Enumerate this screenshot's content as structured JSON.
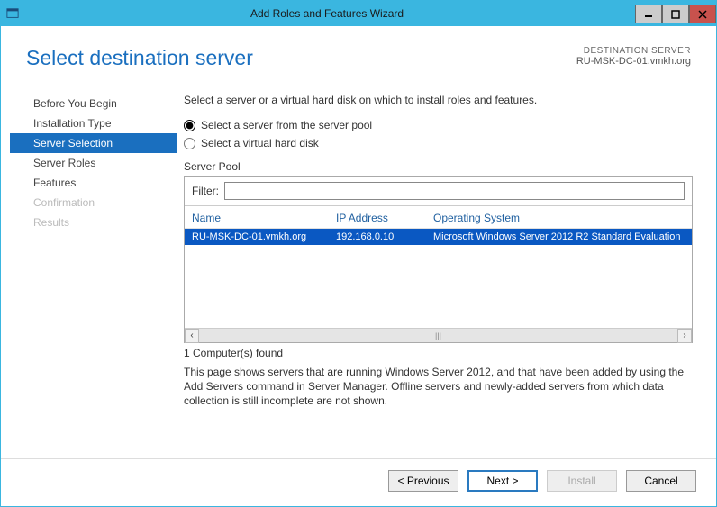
{
  "window": {
    "title": "Add Roles and Features Wizard"
  },
  "header": {
    "heading": "Select destination server",
    "dest_label": "DESTINATION SERVER",
    "dest_value": "RU-MSK-DC-01.vmkh.org"
  },
  "sidebar": {
    "items": [
      {
        "label": "Before You Begin",
        "state": "done"
      },
      {
        "label": "Installation Type",
        "state": "done"
      },
      {
        "label": "Server Selection",
        "state": "active"
      },
      {
        "label": "Server Roles",
        "state": "done"
      },
      {
        "label": "Features",
        "state": "done"
      },
      {
        "label": "Confirmation",
        "state": "disabled"
      },
      {
        "label": "Results",
        "state": "disabled"
      }
    ]
  },
  "main": {
    "instruction": "Select a server or a virtual hard disk on which to install roles and features.",
    "radio1": "Select a server from the server pool",
    "radio2": "Select a virtual hard disk",
    "pool_label": "Server Pool",
    "filter_label": "Filter:",
    "filter_value": "",
    "columns": {
      "name": "Name",
      "ip": "IP Address",
      "os": "Operating System"
    },
    "rows": [
      {
        "name": "RU-MSK-DC-01.vmkh.org",
        "ip": "192.168.0.10",
        "os": "Microsoft Windows Server 2012 R2 Standard Evaluation"
      }
    ],
    "count": "1 Computer(s) found",
    "note": "This page shows servers that are running Windows Server 2012, and that have been added by using the Add Servers command in Server Manager. Offline servers and newly-added servers from which data collection is still incomplete are not shown."
  },
  "footer": {
    "previous": "< Previous",
    "next": "Next >",
    "install": "Install",
    "cancel": "Cancel"
  }
}
